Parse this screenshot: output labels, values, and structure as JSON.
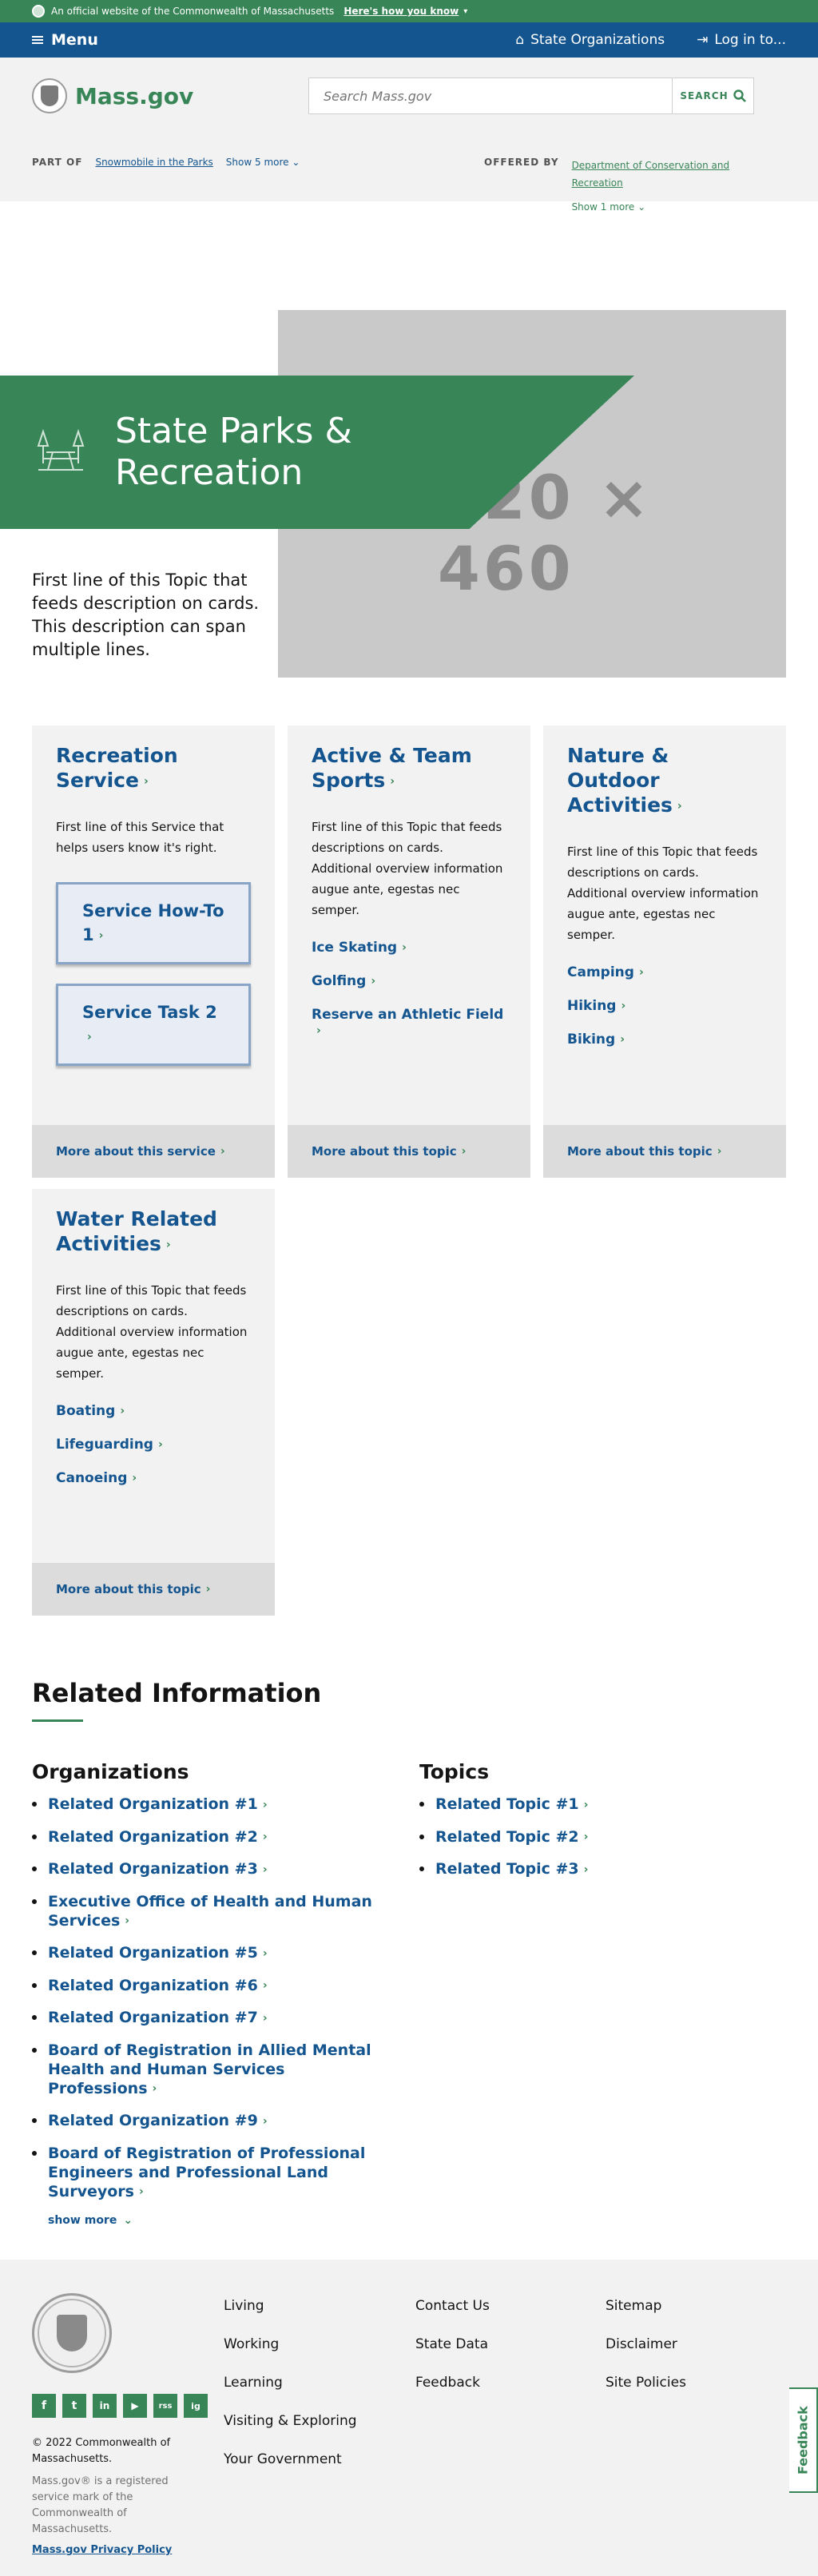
{
  "banner": {
    "text": "An official website of the Commonwealth of Massachusetts",
    "how": "Here's how you know"
  },
  "nav": {
    "menu": "Menu",
    "orgs": "State Organizations",
    "login": "Log in to..."
  },
  "header": {
    "logo": "Mass.gov",
    "search_placeholder": "Search Mass.gov",
    "search_button": "SEARCH"
  },
  "relations": {
    "part_of_label": "PART OF",
    "part_of_link": "Snowmobile in the Parks",
    "show_more": "Show 5 more",
    "offered_label": "OFFERED BY",
    "offered_link": "Department of Conservation and Recreation",
    "offered_more": "Show 1 more"
  },
  "hero": {
    "title": "State Parks & Recreation",
    "image_text": "620 × 460",
    "description": "First line of this Topic that feeds description on cards. This description can span multiple lines."
  },
  "cards": [
    {
      "title": "Recreation Service",
      "desc": "First line of this Service that helps users know it's right.",
      "buttons": [
        "Service How-To 1",
        "Service Task 2"
      ],
      "footer": "More about this service"
    },
    {
      "title": "Active & Team Sports",
      "desc": "First line of this Topic that feeds descriptions on cards. Additional overview information augue ante, egestas nec semper.",
      "links": [
        "Ice Skating",
        "Golfing",
        "Reserve an Athletic Field"
      ],
      "footer": "More about this topic"
    },
    {
      "title": "Nature & Outdoor Activities",
      "desc": "First line of this Topic that feeds descriptions on cards. Additional overview information augue ante, egestas nec semper.",
      "links": [
        "Camping",
        "Hiking",
        "Biking"
      ],
      "footer": "More about this topic"
    },
    {
      "title": "Water Related Activities",
      "desc": "First line of this Topic that feeds descriptions on cards. Additional overview information augue ante, egestas nec semper.",
      "links": [
        "Boating",
        "Lifeguarding",
        "Canoeing"
      ],
      "footer": "More about this topic"
    }
  ],
  "related": {
    "title": "Related Information",
    "orgs_title": "Organizations",
    "orgs": [
      "Related Organization #1",
      "Related Organization #2",
      "Related Organization #3",
      "Executive Office of Health and Human Services",
      "Related Organization #5",
      "Related Organization #6",
      "Related Organization #7",
      "Board of Registration in Allied Mental Health and Human Services Professions",
      "Related Organization #9",
      "Board of Registration of Professional Engineers and Professional Land Surveyors"
    ],
    "show_more": "show more",
    "topics_title": "Topics",
    "topics": [
      "Related Topic #1",
      "Related Topic #2",
      "Related Topic #3"
    ]
  },
  "footer": {
    "copyright": "© 2022 Commonwealth of Massachusetts.",
    "trademark": "Mass.gov® is a registered service mark of the Commonwealth of Massachusetts.",
    "privacy": "Mass.gov Privacy Policy",
    "col1": [
      "Living",
      "Working",
      "Learning",
      "Visiting & Exploring",
      "Your Government"
    ],
    "col2": [
      "Contact Us",
      "State Data",
      "Feedback"
    ],
    "col3": [
      "Sitemap",
      "Disclaimer",
      "Site Policies"
    ],
    "social": [
      "f",
      "t",
      "in",
      "▶",
      "rss",
      "ig"
    ]
  },
  "feedback_tab": "Feedback"
}
